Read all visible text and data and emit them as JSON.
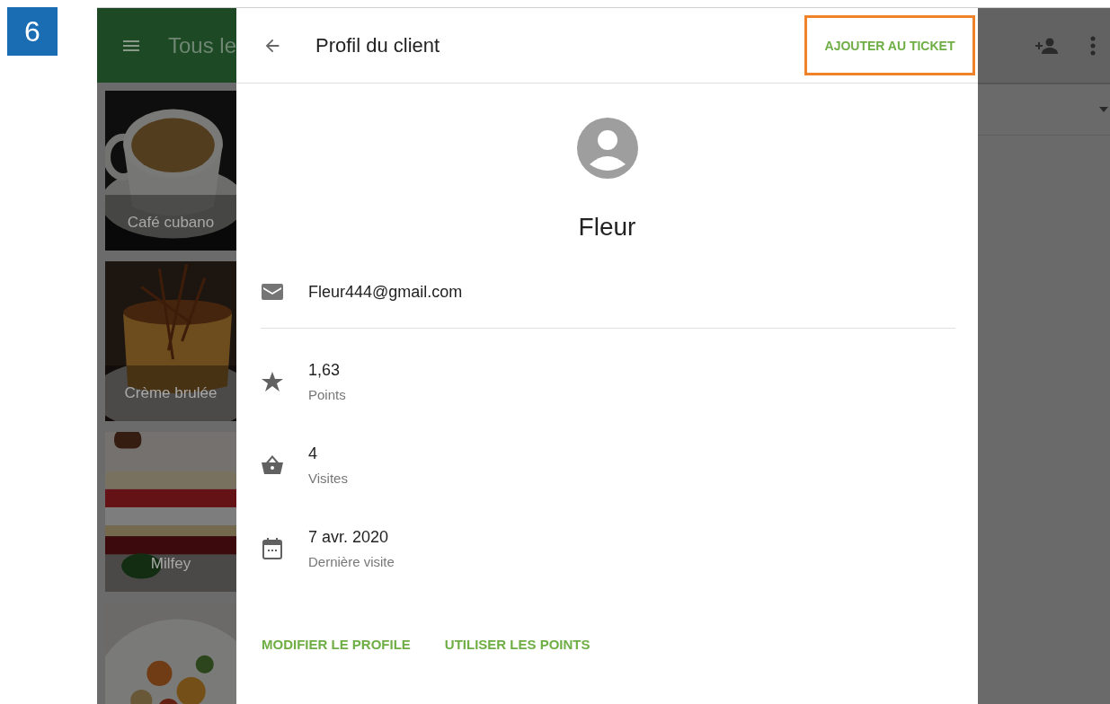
{
  "step_badge": "6",
  "background_app": {
    "title": "Tous le",
    "tiles": [
      {
        "kind": "item",
        "label": "Café cubano"
      },
      {
        "kind": "item",
        "label": "Crème brulée"
      },
      {
        "kind": "item",
        "label": "Milfey"
      },
      {
        "kind": "picture"
      }
    ]
  },
  "dialog": {
    "title": "Profil du client",
    "action": {
      "label": "AJOUTER AU TICKET",
      "highlighted": true
    },
    "customer": {
      "name": "Fleur",
      "email": "Fleur444@gmail.com"
    },
    "stats": [
      {
        "kind": "points",
        "value": "1,63",
        "label": "Points"
      },
      {
        "kind": "visits",
        "value": "4",
        "label": "Visites"
      },
      {
        "kind": "last_visit",
        "value": "7 avr. 2020",
        "label": "Dernière visite"
      }
    ],
    "buttons": [
      "MODIFIER LE PROFILE",
      "UTILISER LES POINTS"
    ]
  }
}
